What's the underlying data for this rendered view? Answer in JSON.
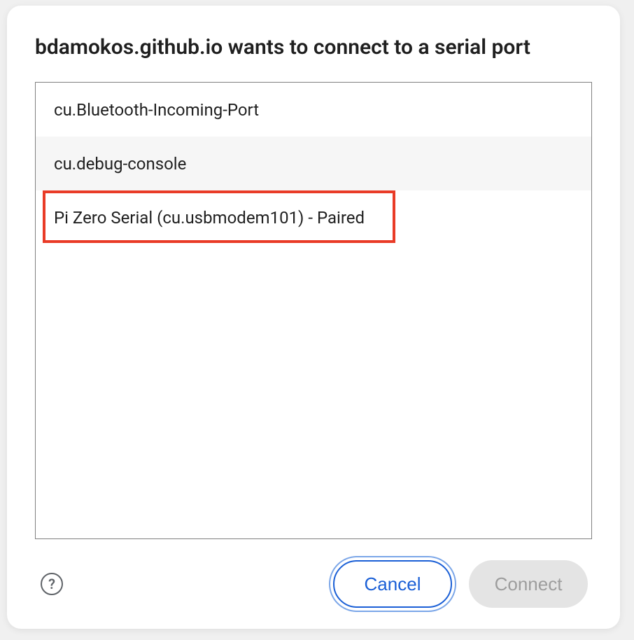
{
  "dialog": {
    "title": "bdamokos.github.io wants to connect to a serial port",
    "ports": [
      {
        "label": "cu.Bluetooth-Incoming-Port"
      },
      {
        "label": "cu.debug-console"
      },
      {
        "label": "Pi Zero Serial (cu.usbmodem101) - Paired"
      }
    ],
    "help_glyph": "?",
    "buttons": {
      "cancel": "Cancel",
      "connect": "Connect"
    }
  },
  "colors": {
    "highlight_border": "#e93b27",
    "accent_blue": "#1a5fd6",
    "disabled_bg": "#e4e4e4",
    "disabled_text": "#9d9d9d"
  }
}
